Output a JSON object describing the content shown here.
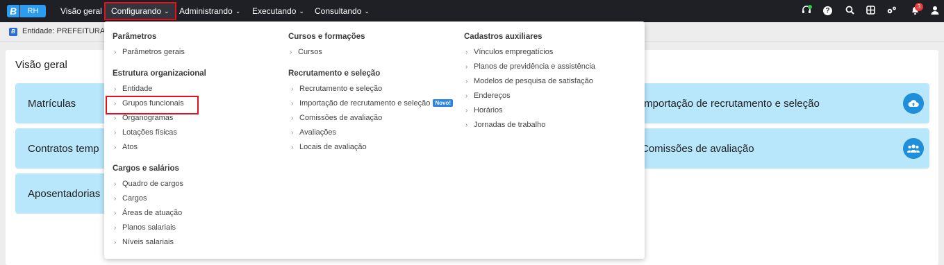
{
  "logo": {
    "mark": "B",
    "product": "RH"
  },
  "nav": {
    "items": [
      {
        "label": "Visão geral"
      },
      {
        "label": "Configurando"
      },
      {
        "label": "Administrando"
      },
      {
        "label": "Executando"
      },
      {
        "label": "Consultando"
      }
    ],
    "chevron": "⌄",
    "notification_count": "3"
  },
  "entity": {
    "label": "Entidade: PREFEITURA D"
  },
  "page": {
    "title": "Visão geral",
    "cards": [
      {
        "label": "Matrículas"
      },
      {
        "label": "Contratos temp"
      },
      {
        "label": "Aposentadorias"
      },
      {
        "label": "Importação de recrutamento e seleção",
        "icon": "cloud-upload-icon"
      },
      {
        "label": "Comissões de avaliação",
        "icon": "users-icon"
      }
    ]
  },
  "menu": {
    "col1": {
      "sections": [
        {
          "title": "Parâmetros",
          "items": [
            "Parâmetros gerais"
          ]
        },
        {
          "title": "Estrutura organizacional",
          "items": [
            "Entidade",
            "Grupos funcionais",
            "Organogramas",
            "Lotações físicas",
            "Atos"
          ]
        },
        {
          "title": "Cargos e salários",
          "items": [
            "Quadro de cargos",
            "Cargos",
            "Áreas de atuação",
            "Planos salariais",
            "Níveis salariais"
          ]
        }
      ]
    },
    "col2": {
      "sections": [
        {
          "title": "Cursos e formações",
          "items": [
            "Cursos"
          ]
        },
        {
          "title": "Recrutamento e seleção",
          "items": [
            "Recrutamento e seleção",
            "Importação de recrutamento e seleção",
            "Comissões de avaliação",
            "Avaliações",
            "Locais de avaliação"
          ]
        }
      ],
      "new_badge": "Novo!"
    },
    "col3": {
      "sections": [
        {
          "title": "Cadastros auxiliares",
          "items": [
            "Vínculos empregatícios",
            "Planos de previdência e assistência",
            "Modelos de pesquisa de satisfação",
            "Endereços",
            "Horários",
            "Jornadas de trabalho"
          ]
        }
      ]
    },
    "arrow": "›"
  },
  "colors": {
    "navbar": "#1f2025",
    "accent_red": "#e3111d",
    "card_bg": "#b8e6fb",
    "brand_blue": "#2b9cf2"
  }
}
